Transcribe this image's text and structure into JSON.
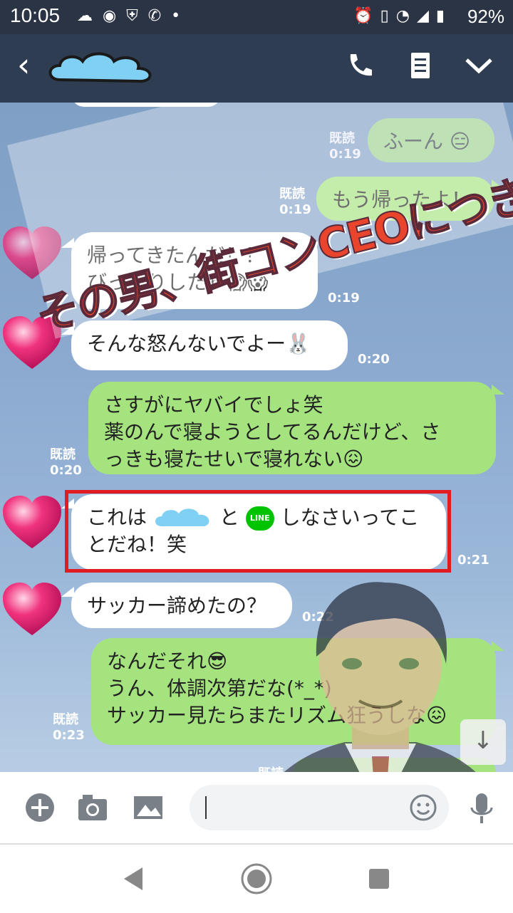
{
  "status_bar": {
    "time": "10:05",
    "battery": "92%",
    "icons": [
      "cloud-icon",
      "speaker-icon",
      "shield-icon",
      "phone-shield-icon",
      "dot-icon",
      "alarm-icon",
      "vibrate-icon",
      "wifi-icon",
      "signal-icon",
      "battery-icon"
    ]
  },
  "header": {
    "back_glyph": "‹",
    "icons": [
      "phone-icon",
      "note-icon",
      "chevron-down-icon"
    ]
  },
  "overlay": {
    "watermark_text": "その男、街コンCEOにつき。"
  },
  "messages": [
    {
      "side": "right",
      "text": "ふーん 😑",
      "read": "既読",
      "time": "0:19"
    },
    {
      "side": "right",
      "text": "もう帰ったよ！",
      "read": "既読",
      "time": "0:19"
    },
    {
      "side": "left",
      "text": "帰ってきたんだ！！\nびっくりしたわ😱😱",
      "time": "0:19"
    },
    {
      "side": "left",
      "text": "そんな怒んないでよー🐰",
      "time": "0:20"
    },
    {
      "side": "right",
      "text": "さすがにヤバイでしょ笑\n薬のんで寝ようとしてるんだけど、さ\nっきも寝たせいで寝れない😖",
      "read": "既読",
      "time": "0:20"
    },
    {
      "side": "left",
      "text_before": "これは",
      "text_middle": "と",
      "line_badge": "LINE",
      "text_after": "しなさいってこ\nとだね！笑",
      "time": "0:21"
    },
    {
      "side": "left",
      "text": "サッカー諦めたの？",
      "time": "0:22"
    },
    {
      "side": "right",
      "text": "なんだそれ😎\nうん、体調次第だな(*_*)\nサッカー見たらまたリズム狂うしな😖",
      "read": "既読",
      "time": "0:23"
    },
    {
      "side": "right",
      "text": "",
      "read": "既読",
      "time": ""
    }
  ],
  "input": {
    "icons": [
      "plus-icon",
      "camera-icon",
      "image-icon",
      "emoji-icon",
      "mic-icon"
    ]
  },
  "navbar": {
    "icons": [
      "back-triangle-icon",
      "home-circle-icon",
      "recents-square-icon"
    ]
  },
  "colors": {
    "header_bg": "#2f3d53",
    "status_bg": "#2b3444",
    "green_bubble": "#a5e37f",
    "white_bubble": "#ffffff",
    "highlight": "#e01b22",
    "heart": "#f0337d"
  }
}
